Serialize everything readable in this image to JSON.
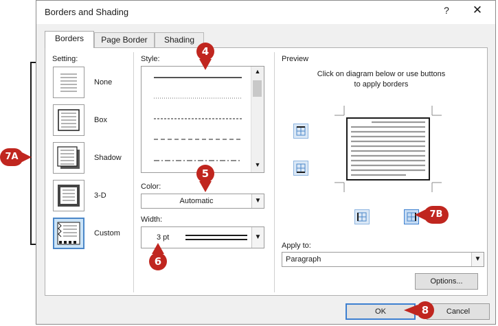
{
  "window": {
    "title": "Borders and Shading",
    "help_glyph": "?",
    "close_glyph": "✕"
  },
  "tabs": [
    {
      "label": "Borders",
      "active": true
    },
    {
      "label": "Page Border",
      "active": false
    },
    {
      "label": "Shading",
      "active": false
    }
  ],
  "setting": {
    "label": "Setting:",
    "items": [
      {
        "label": "None"
      },
      {
        "label": "Box"
      },
      {
        "label": "Shadow"
      },
      {
        "label": "3-D"
      },
      {
        "label": "Custom",
        "selected": true
      }
    ]
  },
  "style": {
    "label": "Style:"
  },
  "color": {
    "label": "Color:",
    "value": "Automatic"
  },
  "width": {
    "label": "Width:",
    "value": "3 pt"
  },
  "preview": {
    "label": "Preview",
    "hint_line1": "Click on diagram below or use buttons",
    "hint_line2": "to apply borders"
  },
  "apply_to": {
    "label": "Apply to:",
    "value": "Paragraph"
  },
  "buttons": {
    "options": "Options...",
    "ok": "OK",
    "cancel": "Cancel"
  },
  "callouts": {
    "c4": "4",
    "c5": "5",
    "c6": "6",
    "c7a": "7A",
    "c7b": "7B",
    "c8": "8"
  },
  "colors": {
    "accent": "#3c7fd0",
    "callout": "#c0261f",
    "selected_fill": "#cce4f7"
  }
}
